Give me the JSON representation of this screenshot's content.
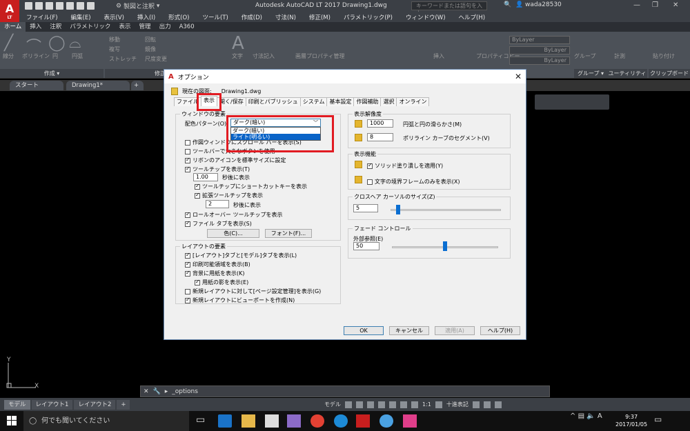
{
  "titlebar": {
    "title": "Autodesk AutoCAD LT 2017    Drawing1.dwg",
    "workspace": "製図と注釈",
    "search_placeholder": "キーワードまたは語句を入力",
    "username": "wada28530"
  },
  "app": {
    "logo": "A",
    "logo_sub": "LT"
  },
  "menu": [
    "ファイル(F)",
    "編集(E)",
    "表示(V)",
    "挿入(I)",
    "形式(O)",
    "ツール(T)",
    "作成(D)",
    "寸法(N)",
    "修正(M)",
    "パラメトリック(P)",
    "ウィンドウ(W)",
    "ヘルプ(H)"
  ],
  "ribbon_tabs": [
    "ホーム",
    "挿入",
    "注釈",
    "パラメトリック",
    "表示",
    "管理",
    "出力",
    "A360"
  ],
  "ribbon": {
    "panels": [
      "作成 ▾",
      "修正",
      "グループ ▾",
      "ユーティリティ ▾",
      "クリップボード"
    ],
    "tools": [
      "線分",
      "ポリライン",
      "円",
      "円弧",
      "移動",
      "複写",
      "ストレッチ",
      "回転",
      "鏡像",
      "尺度変更",
      "文字",
      "寸法記入",
      "画層プロパティ管理",
      "挿入",
      "プロパティコピー",
      "グループ",
      "計測",
      "貼り付け"
    ],
    "bylayer": [
      "ByLayer",
      "ByLayer",
      "ByLayer"
    ]
  },
  "doc_tabs": [
    "スタート",
    "Drawing1*",
    "+"
  ],
  "layout_tabs": [
    "モデル",
    "レイアウト1",
    "レイアウト2",
    "+"
  ],
  "status": {
    "model": "モデル",
    "scale": "1:1",
    "units": "十進表記"
  },
  "cmdline": {
    "text": "_options"
  },
  "ucs": {
    "x": "X",
    "y": "Y"
  },
  "taskbar": {
    "search": "何でも聞いてください",
    "ime": "A",
    "time": "9:37",
    "date": "2017/01/05"
  },
  "dialog": {
    "title": "オプション",
    "profile_label": "現在の図面:",
    "profile_value": "Drawing1.dwg",
    "tabs": [
      "ファイル",
      "表示",
      "開く/保存",
      "印刷とパブリッシュ",
      "システム",
      "基本設定",
      "作図補助",
      "選択",
      "オンライン"
    ],
    "window_group": "ウィンドウの要素",
    "color_scheme_label": "配色パターン(O)",
    "color_scheme_value": "ダーク(暗い)",
    "color_options": [
      "ダーク(暗い)",
      "ライト(明るい)"
    ],
    "window_checks": [
      {
        "label": "作図ウィンドウにスクロール バーを表示(S)",
        "on": false
      },
      {
        "label": "ツールバーで大きなボタンを使用",
        "on": false
      },
      {
        "label": "リボンのアイコンを標準サイズに設定",
        "on": true
      },
      {
        "label": "ツールチップを表示(T)",
        "on": true
      }
    ],
    "tooltip_delay": "1.00",
    "tooltip_delay_label": "秒後に表示",
    "tooltip_shortcut": "ツールチップにショートカットキーを表示",
    "tooltip_extended": "拡張ツールチップを表示",
    "ext_delay": "2",
    "ext_delay_label": "秒後に表示",
    "rollover": "ロールオーバー ツールチップを表示",
    "file_tabs": "ファイル タブを表示(S)",
    "btn_color": "色(C)...",
    "btn_font": "フォント(F)...",
    "layout_group": "レイアウトの要素",
    "layout_checks": [
      {
        "label": "[レイアウト]タブと[モデル]タブを表示(L)",
        "on": true
      },
      {
        "label": "印刷可能領域を表示(B)",
        "on": true
      },
      {
        "label": "背景に用紙を表示(K)",
        "on": true
      },
      {
        "label": "用紙の影を表示(E)",
        "on": true
      },
      {
        "label": "新規レイアウトに対して[ページ設定管理]を表示(G)",
        "on": false
      },
      {
        "label": "新規レイアウトにビューポートを作成(N)",
        "on": true
      }
    ],
    "resolution_group": "表示解像度",
    "arc_value": "1000",
    "arc_label": "円弧と円の滑らかさ(M)",
    "pline_value": "8",
    "pline_label": "ポリライン カーブのセグメント(V)",
    "perf_group": "表示機能",
    "solid_fill": "ソリッド塗り潰しを適用(Y)",
    "text_frame": "文字の境界フレームのみを表示(X)",
    "crosshair_group": "クロスヘア カーソルのサイズ(Z)",
    "crosshair_value": "5",
    "crosshair_level": 0.05,
    "fade_group": "フェード コントロール",
    "xref_label": "外部参照(E)",
    "xref_value": "50",
    "xref_level": 0.5,
    "btn_ok": "OK",
    "btn_cancel": "キャンセル",
    "btn_apply": "適用(A)",
    "btn_help": "ヘルプ(H)"
  }
}
